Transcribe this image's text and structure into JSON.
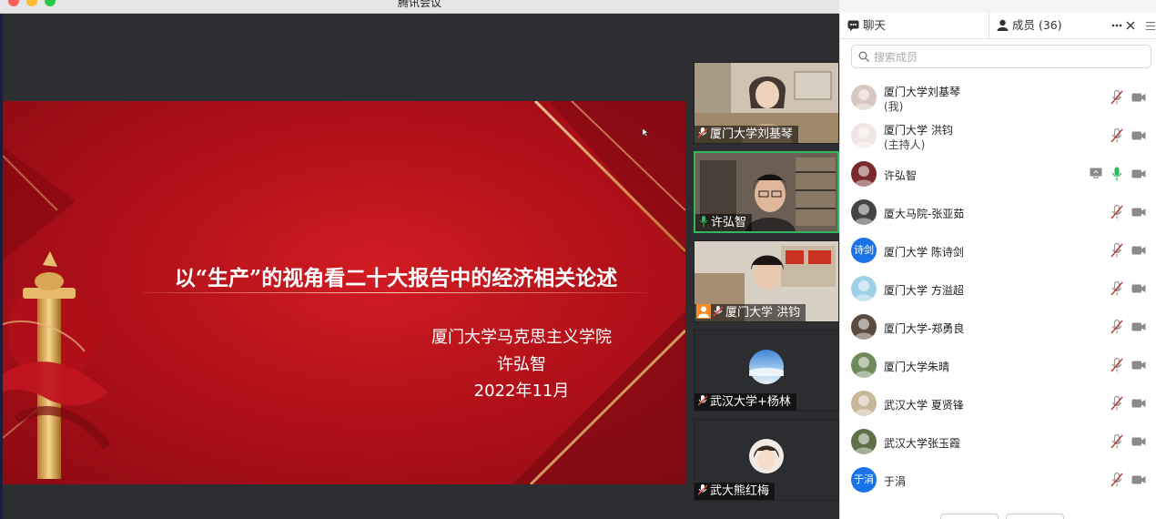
{
  "window": {
    "title": "腾讯会议"
  },
  "slide": {
    "title": "以“生产”的视角看二十大报告中的经济相关论述",
    "institution": "厦门大学马克思主义学院",
    "presenter": "许弘智",
    "date": "2022年11月"
  },
  "video_tiles": [
    {
      "name": "厦门大学刘基琴",
      "speaking": false
    },
    {
      "name": "许弘智",
      "speaking": true
    },
    {
      "name": "厦门大学 洪钧",
      "speaking": false,
      "host": true
    },
    {
      "name": "武汉大学+杨林",
      "speaking": false
    },
    {
      "name": "武大熊红梅",
      "speaking": false
    }
  ],
  "panel": {
    "tab_chat": "聊天",
    "tab_members": "成员 (36)",
    "more_icon": "more-horizontal-icon",
    "search_placeholder": "搜索成员",
    "members": [
      {
        "name": "厦门大学刘基琴",
        "role": "(我)",
        "avatar_text": "",
        "avatar_color": "#d8c6c0",
        "mic": "muted"
      },
      {
        "name": "厦门大学 洪钧",
        "role": "(主持人)",
        "avatar_text": "",
        "avatar_color": "#f1e6e6",
        "mic": "muted"
      },
      {
        "name": "许弘智",
        "role": "",
        "avatar_text": "",
        "avatar_color": "#7a2a2a",
        "mic": "on",
        "sharing": true
      },
      {
        "name": "厦大马院-张亚茹",
        "role": "",
        "avatar_text": "",
        "avatar_color": "#444444",
        "mic": "muted"
      },
      {
        "name": "厦门大学 陈诗剑",
        "role": "",
        "avatar_text": "诗剑",
        "avatar_color": "#1a73e8",
        "mic": "muted"
      },
      {
        "name": "厦门大学 方溢超",
        "role": "",
        "avatar_text": "",
        "avatar_color": "#9fd0e8",
        "mic": "muted"
      },
      {
        "name": "厦门大学-郑勇良",
        "role": "",
        "avatar_text": "",
        "avatar_color": "#5a4b3e",
        "mic": "muted"
      },
      {
        "name": "厦门大学朱晴",
        "role": "",
        "avatar_text": "",
        "avatar_color": "#6f8a5a",
        "mic": "muted"
      },
      {
        "name": "武汉大学 夏贤锋",
        "role": "",
        "avatar_text": "",
        "avatar_color": "#c9b79a",
        "mic": "muted"
      },
      {
        "name": "武汉大学张玉霞",
        "role": "",
        "avatar_text": "",
        "avatar_color": "#5e6f4a",
        "mic": "muted"
      },
      {
        "name": "于涓",
        "role": "",
        "avatar_text": "于涓",
        "avatar_color": "#1a73e8",
        "mic": "muted"
      }
    ]
  },
  "colors": {
    "speaking_border": "#2fb760",
    "mic_on": "#2fb760",
    "mic_muted": "#c0392b",
    "avatar_blue": "#1a73e8"
  }
}
